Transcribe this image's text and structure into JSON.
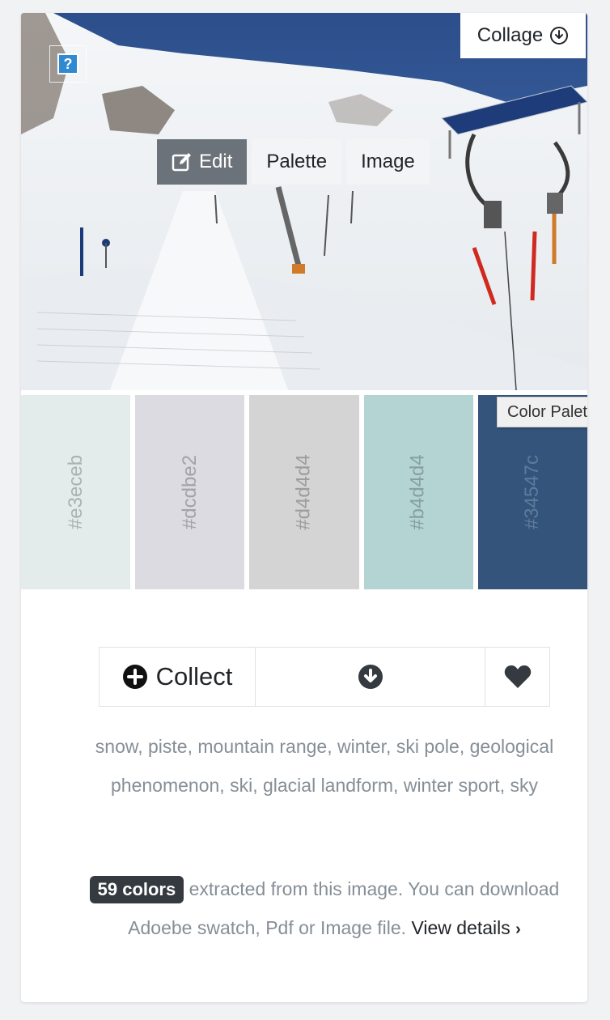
{
  "photo": {
    "collage_label": "Collage",
    "help_label": "?",
    "tabs": [
      {
        "label": "Edit",
        "active": true
      },
      {
        "label": "Palette",
        "active": false
      },
      {
        "label": "Image",
        "active": false
      }
    ]
  },
  "palette": {
    "swatches": [
      {
        "hex": "#e3eceb",
        "label": "#e3eceb",
        "text_color": "#a9b3b2"
      },
      {
        "hex": "#dcdbe2",
        "label": "#dcdbe2",
        "text_color": "#a3a2aa"
      },
      {
        "hex": "#d4d4d4",
        "label": "#d4d4d4",
        "text_color": "#9d9d9d"
      },
      {
        "hex": "#b4d4d4",
        "label": "#b4d4d4",
        "text_color": "#879f9f"
      },
      {
        "hex": "#34547c",
        "label": "#34547c",
        "text_color": "#5f7a9c"
      }
    ],
    "tooltip": "Color Palette Ic"
  },
  "actions": {
    "collect_label": "Collect"
  },
  "tags": "snow, piste, mountain range, winter, ski pole, geological phenomenon, ski, glacial landform, winter sport, sky",
  "info": {
    "badge": "59 colors",
    "text": " extracted from this image. You can download Adoebe swatch, Pdf or Image file. ",
    "link": "View details"
  },
  "colors": {
    "sky": "#34547c",
    "snow": "#eef1f2",
    "active_tab": "#6c727a"
  }
}
